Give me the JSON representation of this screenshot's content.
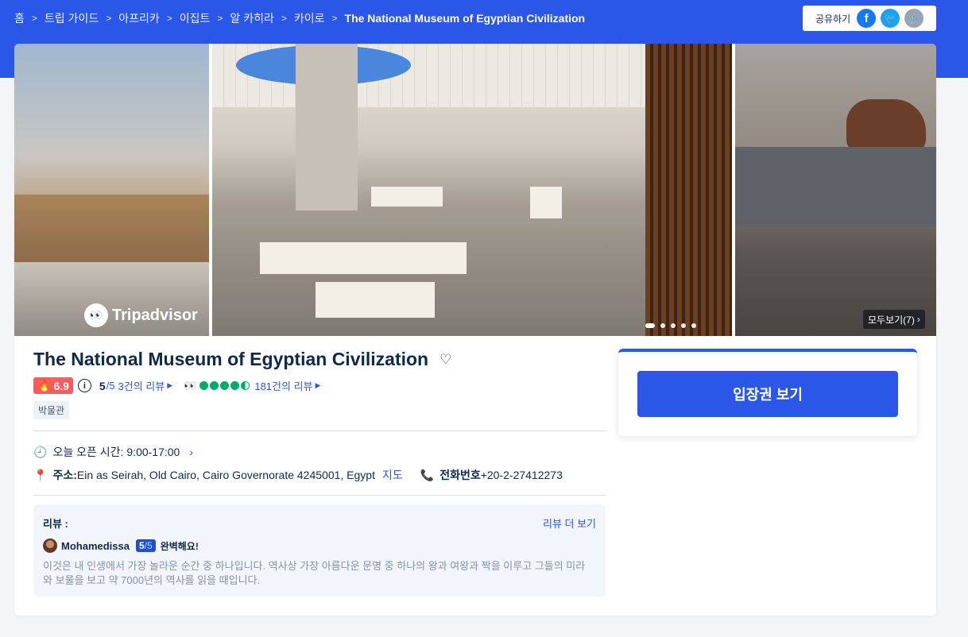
{
  "breadcrumb": {
    "items": [
      "홈",
      "트립 가이드",
      "아프리카",
      "이집트",
      "알 카히라",
      "카이로"
    ],
    "current": "The National Museum of Egyptian Civilization",
    "separator": ">"
  },
  "share": {
    "label": "공유하기",
    "icons": [
      "facebook-icon",
      "twitter-icon",
      "link-icon"
    ],
    "facebook_glyph": "f",
    "twitter_glyph": "🐦",
    "link_glyph": "🔗"
  },
  "gallery": {
    "watermark": "Tripadvisor",
    "view_all": "모두보기(7)",
    "slide_count": 5,
    "active_slide": 1
  },
  "attraction": {
    "title": "The National Museum of Egyptian Civilization",
    "hot_score": "6.9",
    "rating": "5",
    "rating_max": "/5",
    "review_count": "3건의 리뷰",
    "tripadvisor_reviews": "181건의 리뷰",
    "tripadvisor_bubbles": 4.5,
    "category": "박물관",
    "hours_label": "오늘 오픈 시간:",
    "hours": "9:00-17:00",
    "address_label": "주소:",
    "address": "Ein as Seirah, Old Cairo, Cairo Governorate 4245001, Egypt",
    "map_link": "지도",
    "phone_label": "전화번호",
    "phone": "+20-2-27412273"
  },
  "review": {
    "label": "리뷰 :",
    "more": "리뷰 더 보기",
    "user": "Mohamedissa",
    "score": "5",
    "score_max": "/5",
    "verdict": "완벽해요!",
    "text": "이것은 내 인생에서 가장 놀라운 순간 중 하나입니다. 역사상 가장 아름다운 문명 중 하나의 왕과 여왕과 짝을 이루고 그들의 미라와 보물을 보고 약 7000년의 역사를 읽을 때입니다."
  },
  "ticket": {
    "button_label": "입장권 보기"
  },
  "colors": {
    "brand_blue": "#2b57e8",
    "hot_red": "#ff5a5f",
    "tripadvisor_green": "#00aa6c",
    "text_dark": "#0f294d"
  }
}
